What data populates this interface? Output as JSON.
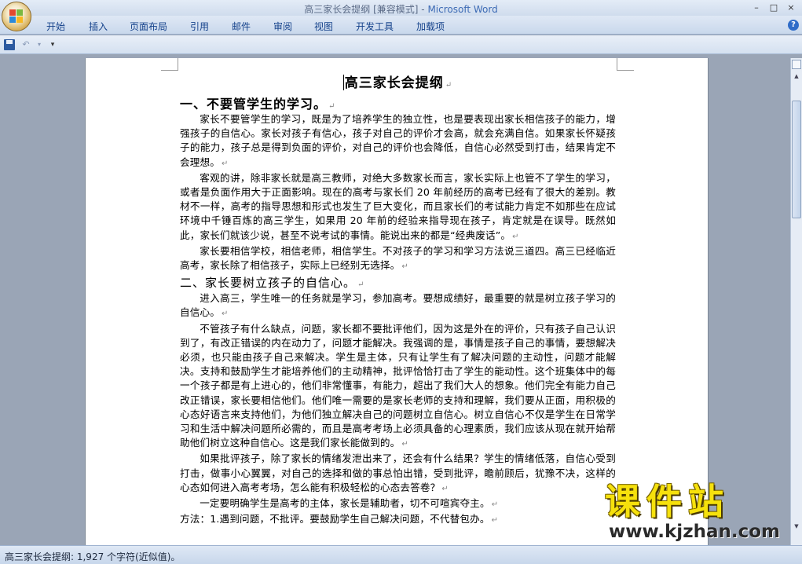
{
  "window": {
    "title": "高三家长会提纲 [兼容模式]",
    "app_name": "Microsoft Word",
    "minimize": "–",
    "maximize": "□",
    "close": "×"
  },
  "ribbon": {
    "tabs": [
      {
        "label": "开始"
      },
      {
        "label": "插入"
      },
      {
        "label": "页面布局"
      },
      {
        "label": "引用"
      },
      {
        "label": "邮件"
      },
      {
        "label": "审阅"
      },
      {
        "label": "视图"
      },
      {
        "label": "开发工具"
      },
      {
        "label": "加载项"
      }
    ],
    "help": "?"
  },
  "quick_access": {
    "undo": "↶",
    "undo_dropdown": "▾",
    "customize": "▾"
  },
  "document": {
    "title": "高三家长会提纲",
    "mark": "↵",
    "sections": [
      {
        "heading": "一、不要管学生的学习。",
        "paragraphs": [
          "家长不要管学生的学习，既是为了培养学生的独立性，也是要表现出家长相信孩子的能力，增强孩子的自信心。家长对孩子有信心，孩子对自己的评价才会高，就会充满自信。如果家长怀疑孩子的能力，孩子总是得到负面的评价，对自己的评价也会降低，自信心必然受到打击，结果肯定不会理想。",
          "客观的讲，除非家长就是高三教师，对绝大多数家长而言，家长实际上也管不了学生的学习，或者是负面作用大于正面影响。现在的高考与家长们 20 年前经历的高考已经有了很大的差别。教材不一样，高考的指导思想和形式也发生了巨大变化，而且家长们的考试能力肯定不如那些在应试环境中千锤百炼的高三学生，如果用 20 年前的经验来指导现在孩子，肯定就是在误导。既然如此，家长们就该少说，甚至不说考试的事情。能说出来的都是“经典废话”。",
          "家长要相信学校，相信老师，相信学生。不对孩子的学习和学习方法说三道四。高三已经临近高考，家长除了相信孩子，实际上已经别无选择。"
        ]
      },
      {
        "heading": "二、家长要树立孩子的自信心。",
        "paragraphs": [
          "进入高三，学生唯一的任务就是学习，参加高考。要想成绩好，最重要的就是树立孩子学习的自信心。",
          "不管孩子有什么缺点，问题，家长都不要批评他们，因为这是外在的评价，只有孩子自己认识到了，有改正错误的内在动力了，问题才能解决。我强调的是，事情是孩子自己的事情，要想解决必须，也只能由孩子自己来解决。学生是主体，只有让学生有了解决问题的主动性，问题才能解决。支持和鼓励学生才能培养他们的主动精神，批评恰恰打击了学生的能动性。这个班集体中的每一个孩子都是有上进心的，他们非常懂事，有能力，超出了我们大人的想象。他们完全有能力自己改正错误，家长要相信他们。他们唯一需要的是家长老师的支持和理解，我们要从正面，用积极的心态好语言来支持他们，为他们独立解决自己的问题树立自信心。树立自信心不仅是学生在日常学习和生活中解决问题所必需的，而且是高考考场上必须具备的心理素质，我们应该从现在就开始帮助他们树立这种自信心。这是我们家长能做到的。",
          "如果批评孩子，除了家长的情绪发泄出来了，还会有什么结果？学生的情绪低落，自信心受到打击，做事小心翼翼，对自己的选择和做的事总怕出错，受到批评，瞻前顾后，犹豫不决，这样的心态如何进入高考考场，怎么能有积极轻松的心态去答卷？",
          "一定要明确学生是高考的主体，家长是辅助者，切不可喧宾夺主。"
        ]
      }
    ],
    "method_line": "方法：1.遇到问题，不批评。要鼓励学生自己解决问题，不代替包办。"
  },
  "status_bar": {
    "text": "高三家长会提纲: 1,927 个字符(近似值)。"
  },
  "watermark": {
    "main": "课件站",
    "url": "www.kjzhan.com"
  },
  "colors": {
    "ribbon_text": "#15428b",
    "title_app": "#3d6bb5",
    "watermark_yellow": "#f6e10c",
    "workspace": "#9aa5b6"
  }
}
